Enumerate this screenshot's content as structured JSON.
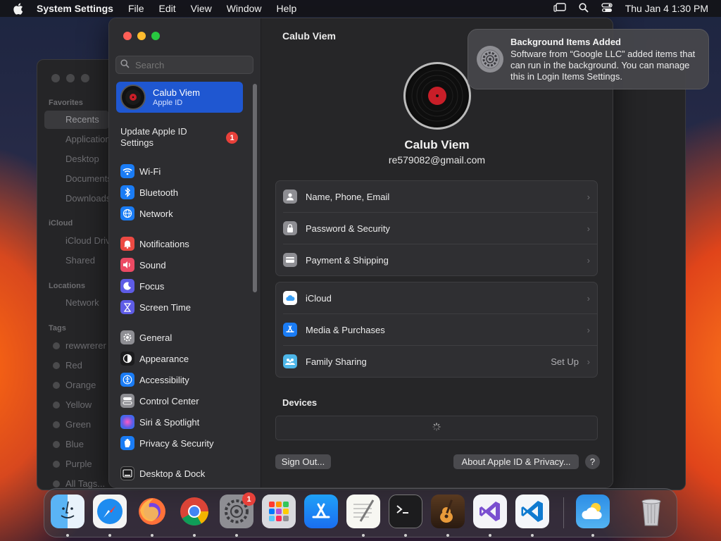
{
  "menubar": {
    "app_name": "System Settings",
    "menus": [
      "File",
      "Edit",
      "View",
      "Window",
      "Help"
    ],
    "clock": "Thu Jan 4  1:30 PM"
  },
  "finder": {
    "sections": {
      "favorites": "Favorites",
      "icloud": "iCloud",
      "locations": "Locations",
      "tags": "Tags"
    },
    "favorites": [
      "Recents",
      "Applications",
      "Desktop",
      "Documents",
      "Downloads"
    ],
    "icloud": [
      "iCloud Drive",
      "Shared"
    ],
    "locations": [
      "Network"
    ],
    "tags": [
      "rewwrerer",
      "Red",
      "Orange",
      "Yellow",
      "Green",
      "Blue",
      "Purple",
      "All Tags..."
    ]
  },
  "sidebar": {
    "search_placeholder": "Search",
    "profile": {
      "name": "Calub Viem",
      "subtitle": "Apple ID"
    },
    "update": {
      "label": "Update Apple ID Settings",
      "badge": "1"
    },
    "items": [
      {
        "label": "Wi-Fi",
        "icon": "wifi-icon",
        "color": "#1a7cf5"
      },
      {
        "label": "Bluetooth",
        "icon": "bluetooth-icon",
        "color": "#1a7cf5"
      },
      {
        "label": "Network",
        "icon": "globe-icon",
        "color": "#1a7cf5"
      },
      {
        "label": "Notifications",
        "icon": "bell-icon",
        "color": "#ec4a43"
      },
      {
        "label": "Sound",
        "icon": "speaker-icon",
        "color": "#ec4a63"
      },
      {
        "label": "Focus",
        "icon": "moon-icon",
        "color": "#5e5ce6"
      },
      {
        "label": "Screen Time",
        "icon": "hourglass-icon",
        "color": "#5e5ce6"
      },
      {
        "label": "General",
        "icon": "gear-icon",
        "color": "#8e8e93"
      },
      {
        "label": "Appearance",
        "icon": "appearance-icon",
        "color": "#1c1c1e"
      },
      {
        "label": "Accessibility",
        "icon": "accessibility-icon",
        "color": "#1a7cf5"
      },
      {
        "label": "Control Center",
        "icon": "control-center-icon",
        "color": "#8e8e93"
      },
      {
        "label": "Siri & Spotlight",
        "icon": "siri-icon",
        "color": "#b24fd6"
      },
      {
        "label": "Privacy & Security",
        "icon": "hand-icon",
        "color": "#1a7cf5"
      },
      {
        "label": "Desktop & Dock",
        "icon": "dock-icon",
        "color": "#1c1c1e"
      }
    ]
  },
  "main": {
    "title": "Calub Viem",
    "name": "Calub Viem",
    "email": "re579082@gmail.com",
    "group1": [
      {
        "label": "Name, Phone, Email",
        "icon": "person-icon",
        "color": "#8e8e93"
      },
      {
        "label": "Password & Security",
        "icon": "lock-icon",
        "color": "#8e8e93"
      },
      {
        "label": "Payment & Shipping",
        "icon": "card-icon",
        "color": "#8e8e93"
      }
    ],
    "group2": [
      {
        "label": "iCloud",
        "icon": "cloud-icon",
        "color": "#ffffff",
        "value": ""
      },
      {
        "label": "Media & Purchases",
        "icon": "app-store-icon",
        "color": "#1a7cf5",
        "value": ""
      },
      {
        "label": "Family Sharing",
        "icon": "family-icon",
        "color": "#4db6e8",
        "value": "Set Up"
      }
    ],
    "devices_heading": "Devices",
    "sign_out": "Sign Out...",
    "about": "About Apple ID & Privacy...",
    "help": "?"
  },
  "notification": {
    "title": "Background Items Added",
    "body": "Software from “Google LLC” added items that can run in the background. You can manage this in Login Items Settings."
  },
  "dock": {
    "settings_badge": "1",
    "apps": [
      "Finder",
      "Safari",
      "Firefox",
      "Chrome",
      "System Settings",
      "Launchpad",
      "App Store",
      "TextEdit",
      "Terminal",
      "GarageBand",
      "Visual Studio",
      "VS Code",
      "Weather",
      "Trash"
    ]
  }
}
